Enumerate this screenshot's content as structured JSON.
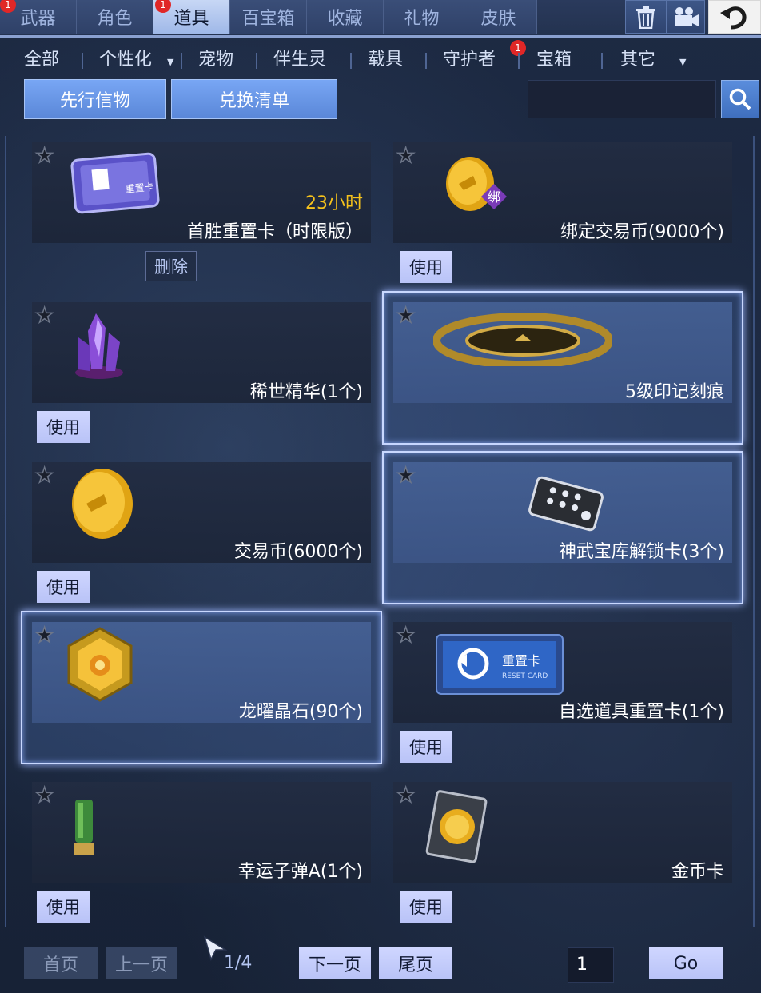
{
  "top_tabs": [
    {
      "label": "武器"
    },
    {
      "label": "角色"
    },
    {
      "label": "道具"
    },
    {
      "label": "百宝箱"
    },
    {
      "label": "收藏"
    },
    {
      "label": "礼物"
    },
    {
      "label": "皮肤"
    }
  ],
  "top_badges": {
    "weapon": "1",
    "props": "1"
  },
  "sub_tabs": [
    {
      "label": "全部"
    },
    {
      "label": "个性化"
    },
    {
      "label": "宠物"
    },
    {
      "label": "伴生灵"
    },
    {
      "label": "载具"
    },
    {
      "label": "守护者"
    },
    {
      "label": "宝箱"
    },
    {
      "label": "其它"
    }
  ],
  "sub_badge": "1",
  "actions": {
    "preorder": "先行信物",
    "exchange": "兑换清单"
  },
  "search": {
    "value": ""
  },
  "items": [
    {
      "name": "首胜重置卡（时限版）",
      "timer": "23小时",
      "action": "删除",
      "icon": "reset-card-icon"
    },
    {
      "name": "绑定交易币(9000个)",
      "action": "使用",
      "icon": "bound-coin-icon",
      "bind_tag": "绑"
    },
    {
      "name": "稀世精华(1个)",
      "action": "使用",
      "icon": "crystal-icon"
    },
    {
      "name": "5级印记刻痕",
      "icon": "ring-mark-icon",
      "selected": true
    },
    {
      "name": "交易币(6000个)",
      "action": "使用",
      "icon": "coin-icon"
    },
    {
      "name": "神武宝库解锁卡(3个)",
      "icon": "unlock-card-icon",
      "selected": true
    },
    {
      "name": "龙曜晶石(90个)",
      "icon": "dragon-gem-icon",
      "selected": true
    },
    {
      "name": "自选道具重置卡(1个)",
      "action": "使用",
      "icon": "reset-card-blue-icon"
    },
    {
      "name": "幸运子弹A(1个)",
      "action": "使用",
      "icon": "bullet-icon"
    },
    {
      "name": "金币卡",
      "action": "使用",
      "icon": "gold-card-icon"
    }
  ],
  "pagination": {
    "first": "首页",
    "prev": "上一页",
    "indicator": "1/4",
    "next": "下一页",
    "last": "尾页",
    "page_input": "1",
    "go": "Go"
  }
}
